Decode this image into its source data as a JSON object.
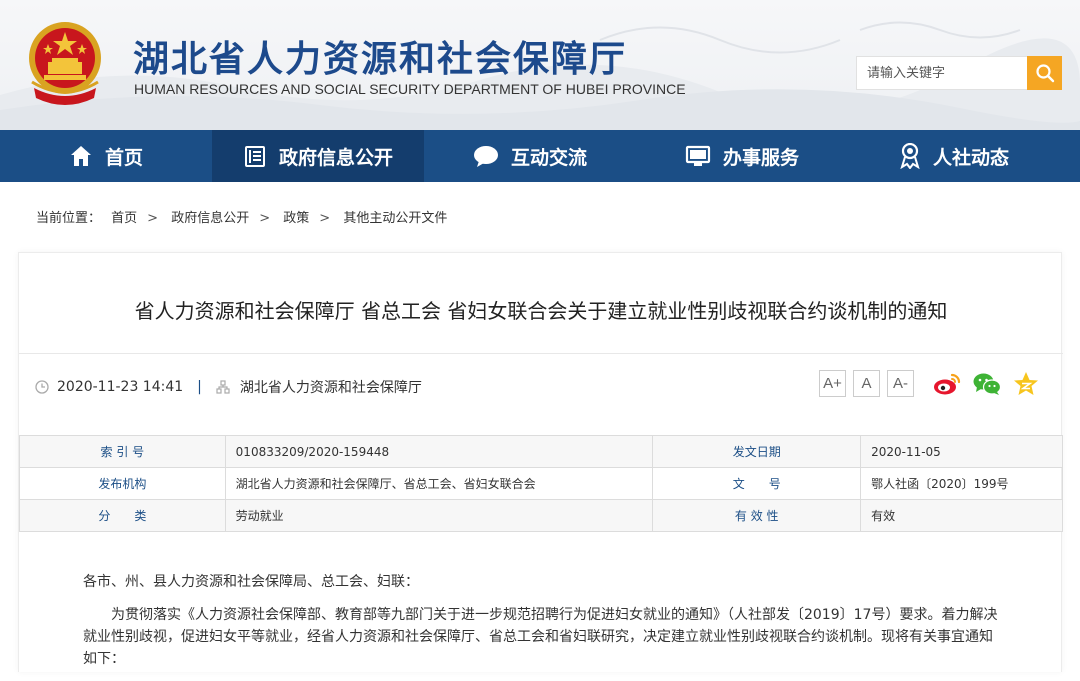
{
  "header": {
    "title": "湖北省人力资源和社会保障厅",
    "subtitle": "HUMAN RESOURCES AND SOCIAL SECURITY DEPARTMENT OF HUBEI PROVINCE",
    "search_placeholder": "请输入关键字",
    "search_icon": "search-icon",
    "accent": "#f5a623",
    "brand": "#1b4e86"
  },
  "nav": {
    "items": [
      {
        "label": "首页",
        "icon": "home-icon"
      },
      {
        "label": "政府信息公开",
        "icon": "document-list-icon",
        "active": true
      },
      {
        "label": "互动交流",
        "icon": "chat-bubble-icon"
      },
      {
        "label": "办事服务",
        "icon": "monitor-icon"
      },
      {
        "label": "人社动态",
        "icon": "award-icon"
      }
    ]
  },
  "breadcrumb": {
    "prefix": "当前位置：",
    "items": [
      "首页",
      "政府信息公开",
      "政策",
      "其他主动公开文件"
    ],
    "separator": ">"
  },
  "article": {
    "title": "省人力资源和社会保障厅 省总工会 省妇女联合会关于建立就业性别歧视联合约谈机制的通知",
    "datetime": "2020-11-23 14:41",
    "source": "湖北省人力资源和社会保障厅",
    "font_buttons": [
      "A+",
      "A",
      "A-"
    ],
    "share_icons": [
      "weibo-icon",
      "wechat-icon",
      "qzone-icon"
    ]
  },
  "info_table": {
    "rows": [
      {
        "l1": "索 引 号",
        "v1": "010833209/2020-159448",
        "l2": "发文日期",
        "v2": "2020-11-05"
      },
      {
        "l1": "发布机构",
        "v1": "湖北省人力资源和社会保障厅、省总工会、省妇女联合会",
        "l2": "文　　号",
        "v2": "鄂人社函〔2020〕199号"
      },
      {
        "l1": "分　　类",
        "v1": "劳动就业",
        "l2": "有 效 性",
        "v2": "有效"
      }
    ]
  },
  "body": {
    "salutation": "各市、州、县人力资源和社会保障局、总工会、妇联：",
    "paragraph1": "为贯彻落实《人力资源社会保障部、教育部等九部门关于进一步规范招聘行为促进妇女就业的通知》（人社部发〔2019〕17号）要求。着力解决就业性别歧视，促进妇女平等就业，经省人力资源和社会保障厅、省总工会和省妇联研究，决定建立就业性别歧视联合约谈机制。现将有关事宜通知如下："
  }
}
